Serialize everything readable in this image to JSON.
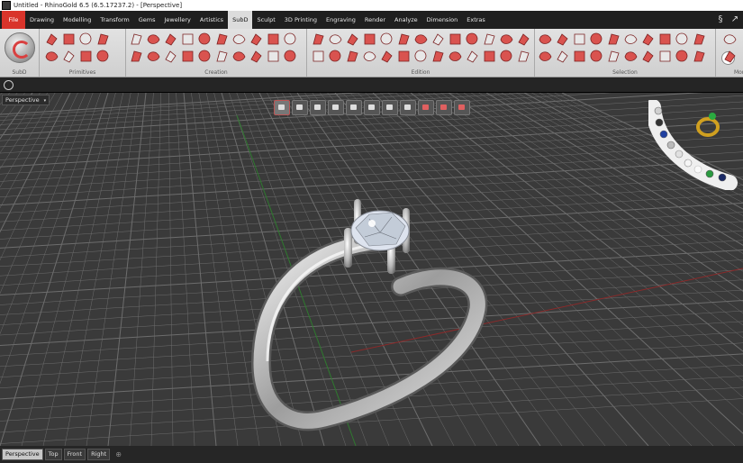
{
  "window": {
    "title": "Untitled - RhinoGold 6.5 (6.5.17237.2) - [Perspective]"
  },
  "menu": {
    "tabs": [
      "File",
      "Drawing",
      "Modelling",
      "Transform",
      "Gems",
      "Jewellery",
      "Artistics",
      "SubD",
      "Sculpt",
      "3D Printing",
      "Engraving",
      "Render",
      "Analyze",
      "Dimension",
      "Extras"
    ],
    "active": "SubD"
  },
  "ribbon": {
    "groups": [
      "SubD",
      "Primitives",
      "Creation",
      "Edition",
      "Selection",
      "Mor"
    ],
    "help_label": "?"
  },
  "viewport": {
    "label": "Perspective",
    "tabs": [
      "Perspective",
      "Top",
      "Front",
      "Right"
    ],
    "active_tab": "Perspective",
    "add_tab_symbol": "⊕"
  },
  "colors": {
    "file_tab": "#d9342b",
    "ribbon_icon": "#d9534f",
    "grid_x_axis": "#8a2a2a",
    "grid_y_axis": "#2a7a2a",
    "viewport_bg": "#3a3a3a"
  }
}
